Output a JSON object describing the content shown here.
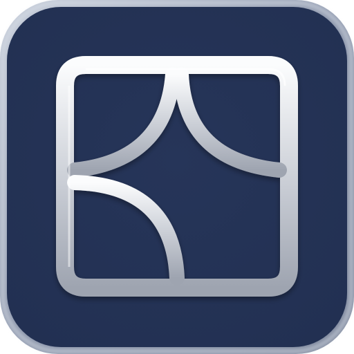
{
  "icon": {
    "name": "app-icon",
    "glyph": "window-curtain-logo-icon",
    "colors": {
      "tile_background": "#263559",
      "tile_frame": "#8e98ad",
      "tile_frame_highlight": "#c9d0dc",
      "logo_light": "#fbfcfd",
      "logo_mid": "#c8ccd4",
      "logo_shadow": "#9ea4b0"
    }
  }
}
